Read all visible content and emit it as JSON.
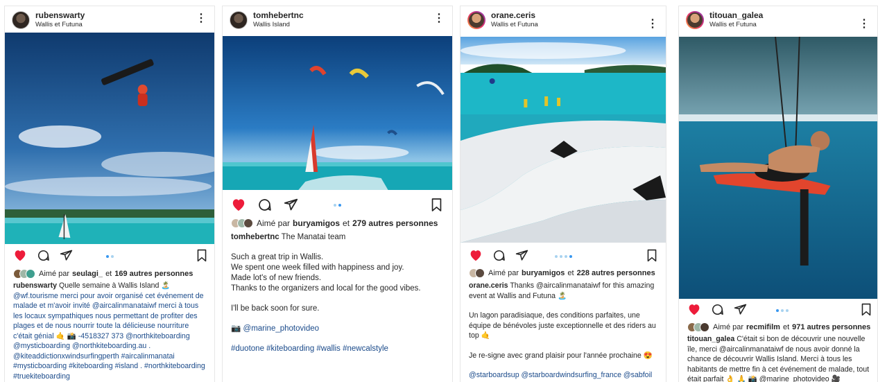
{
  "posts": [
    {
      "username": "rubenswarty",
      "location": "Wallis et Futuna",
      "liked_by_prefix": "Aimé par",
      "liked_by_user": "seulagi_",
      "liked_by_suffix": "et",
      "likes_count": "169 autres personnes",
      "caption_user": "rubenswarty",
      "caption_lines": [
        "Quelle semaine à Wallis Island 🏝️",
        "@wf.tourisme merci pour avoir organisé cet événement de malade et m'avoir invité @aircalinmanataiwf merci à tous les locaux sympathiques nous permettant de profiter des plages et de nous nourrir toute la délicieuse nourriture c'était génial 🤙 📸 -4518327 373 @northkiteboarding @mysticboarding @northkiteboarding.au . @kiteaddictionxwindsurfingperth #aircalinmanatai #mysticboarding #kiteboarding #island . #northkiteboarding #truekiteboarding"
      ],
      "carousel_dots": 2,
      "active_dot": 1
    },
    {
      "username": "tomhebertnc",
      "location": "Wallis Island",
      "liked_by_prefix": "Aimé par",
      "liked_by_user": "buryamigos",
      "liked_by_suffix": "et",
      "likes_count": "279 autres personnes",
      "caption_user": "tomhebertnc",
      "caption_first": "The Manatai team",
      "caption_paragraphs": [
        "Such a great trip in Wallis.",
        "We spent one week filled with happiness and joy.",
        "Made lot's of new friends.",
        "Thanks to the organizers and local for the good vibes.",
        "",
        "I'll be back soon for sure.",
        "",
        "📷 @marine_photovideo",
        "",
        "#duotone #kiteboarding #wallis #newcalstyle"
      ],
      "carousel_dots": 2,
      "active_dot": 1
    },
    {
      "username": "orane.ceris",
      "location": "Wallis et Futuna",
      "liked_by_prefix": "Aimé par",
      "liked_by_user": "buryamigos",
      "liked_by_suffix": "et",
      "likes_count": "228 autres personnes",
      "caption_user": "orane.ceris",
      "caption_first": "Thanks @aircalinmanataiwf for this amazing event at Wallis and Futuna 🏝️",
      "caption_paragraphs": [
        "Un lagon paradisiaque, des conditions parfaites, une équipe de bénévoles juste exceptionnelle et des riders au top 🤙",
        "",
        "Je re-signe avec grand plaisir pour l'année prochaine 😍",
        "",
        "@starboardsup @starboardwindsurfing_france @sabfoil @freewing.world @freewing.france @sooruzofficial @we_are_feel_good_nc @we_are_suneed"
      ],
      "carousel_dots": 4,
      "active_dot": 3
    },
    {
      "username": "titouan_galea",
      "location": "Wallis et Futuna",
      "liked_by_prefix": "Aimé par",
      "liked_by_user": "recmifilm",
      "liked_by_suffix": "et",
      "likes_count": "971 autres personnes",
      "caption_user": "titouan_galea",
      "caption_first": "C'était si bon de découvrir une nouvelle île, merci @aircalinmanataiwf de nous avoir donné la chance de découvrir Wallis Island. Merci à tous les habitants de mettre fin à cet événement de malade, tout était parfait 👌 🙏 📸 @marine_photovideo 🎥 @recmifilm",
      "carousel_dots": 3,
      "active_dot": 1
    }
  ],
  "colors": {
    "heart": "#ed1c3a",
    "link": "#1a4a8a",
    "dot_active": "#3897f0",
    "dot_inactive": "#a8d3f0"
  },
  "icons": [
    "more-options-icon",
    "heart-icon",
    "comment-icon",
    "share-icon",
    "bookmark-icon"
  ]
}
